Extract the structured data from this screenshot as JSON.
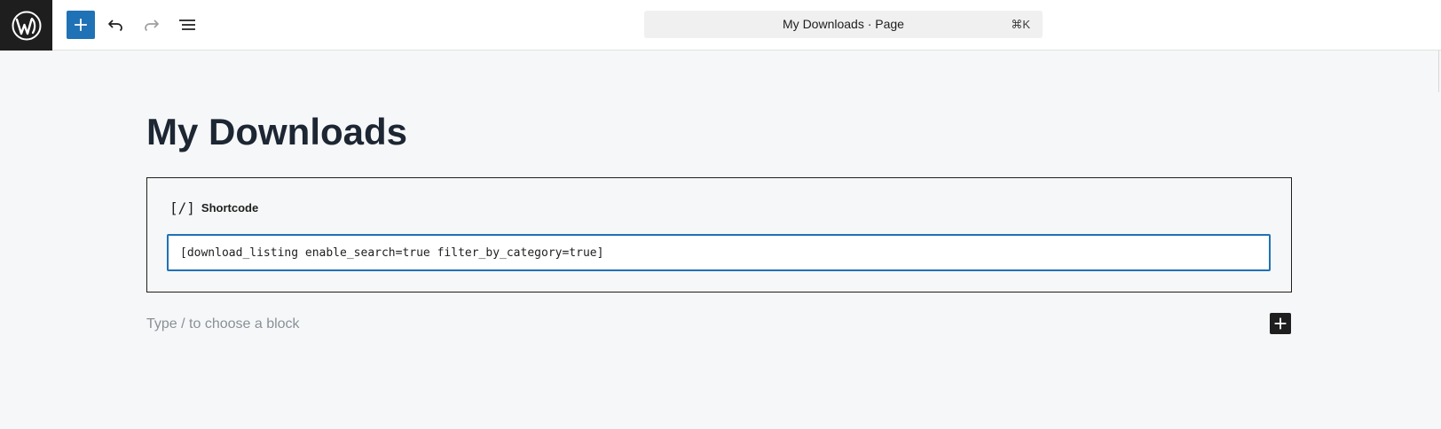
{
  "toolbar": {
    "logo": "wordpress-icon",
    "add_block_icon": "plus-icon",
    "undo_icon": "undo-icon",
    "redo_icon": "redo-icon",
    "document_overview_icon": "list-view-icon"
  },
  "command_bar": {
    "title": "My Downloads · Page",
    "shortcut": "⌘K"
  },
  "editor": {
    "page_title": "My Downloads",
    "shortcode_block": {
      "icon_text": "[/]",
      "label": "Shortcode",
      "value": "[download_listing enable_search=true filter_by_category=true]"
    },
    "placeholder": "Type / to choose a block",
    "inline_add_icon": "plus-icon"
  },
  "colors": {
    "accent": "#1f72b5",
    "title": "#1d2633",
    "placeholder": "#8a9097",
    "canvas": "#f6f7f8"
  }
}
